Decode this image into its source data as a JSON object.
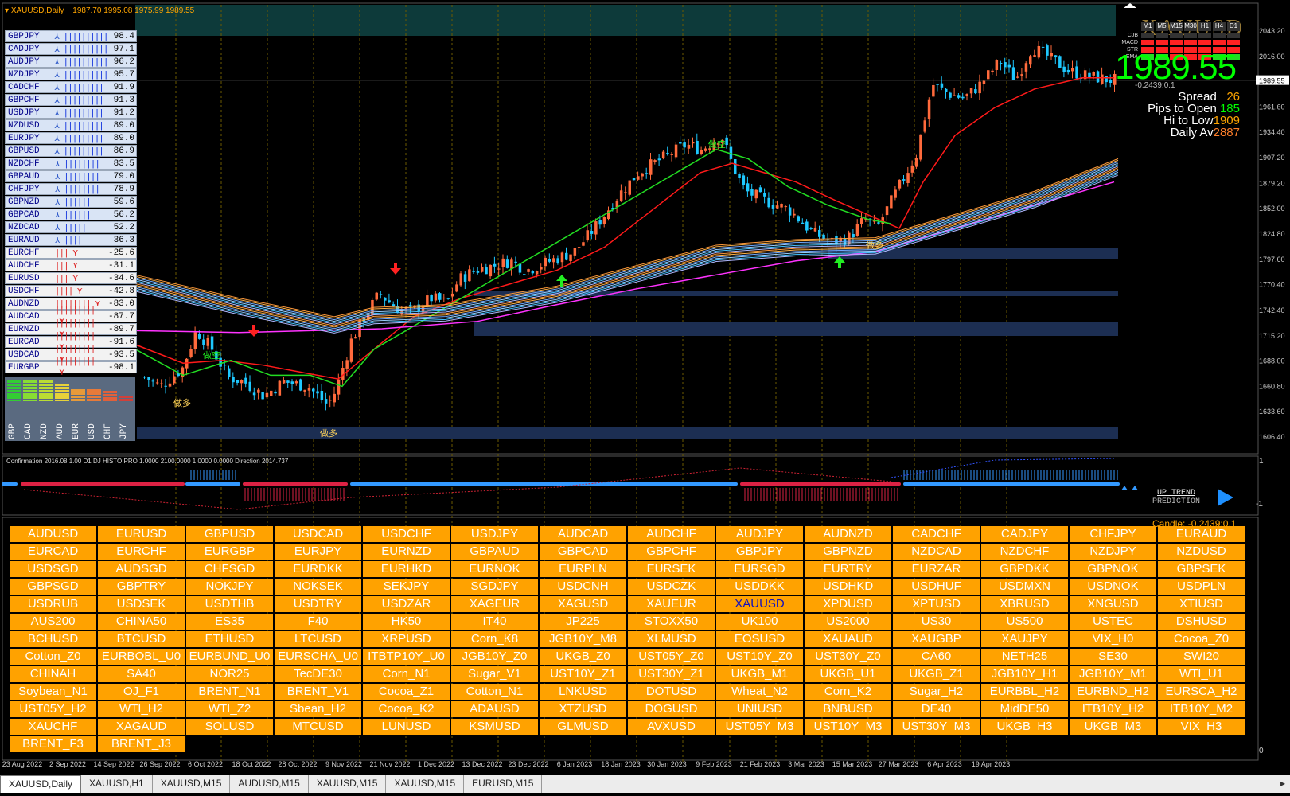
{
  "header": {
    "symbol_label": "XAUUSD,Daily",
    "ohlc": "1987.70 1995.08 1975.99 1989.55",
    "watermark": "XAUUSD"
  },
  "info_panel": {
    "timeframes": [
      "M1",
      "M5",
      "M15",
      "M30",
      "H1",
      "H4",
      "D1"
    ],
    "indicator_rows": [
      "CJB",
      "MACD",
      "STR",
      "EMA"
    ],
    "price": "1989.55",
    "change": "-0.2439:0.1",
    "spread_label": "Spread",
    "spread_value": "26",
    "pips_label": "Pips to Open",
    "pips_value": "185",
    "hilo_label": "Hi to Low",
    "hilo_value": "1909",
    "avg_label": "Daily Av",
    "avg_value": "2887"
  },
  "strength_table": [
    {
      "pair": "GBPJPY",
      "dir": "up",
      "value": "98.4"
    },
    {
      "pair": "CADJPY",
      "dir": "up",
      "value": "97.1"
    },
    {
      "pair": "AUDJPY",
      "dir": "up",
      "value": "96.2"
    },
    {
      "pair": "NZDJPY",
      "dir": "up",
      "value": "95.7"
    },
    {
      "pair": "CADCHF",
      "dir": "up",
      "value": "91.9"
    },
    {
      "pair": "GBPCHF",
      "dir": "up",
      "value": "91.3"
    },
    {
      "pair": "USDJPY",
      "dir": "up",
      "value": "91.2"
    },
    {
      "pair": "NZDUSD",
      "dir": "up",
      "value": "89.0"
    },
    {
      "pair": "EURJPY",
      "dir": "up",
      "value": "89.0"
    },
    {
      "pair": "GBPUSD",
      "dir": "up",
      "value": "86.9"
    },
    {
      "pair": "NZDCHF",
      "dir": "up",
      "value": "83.5"
    },
    {
      "pair": "GBPAUD",
      "dir": "up",
      "value": "79.0"
    },
    {
      "pair": "CHFJPY",
      "dir": "up",
      "value": "78.9"
    },
    {
      "pair": "GBPNZD",
      "dir": "up",
      "value": "59.6"
    },
    {
      "pair": "GBPCAD",
      "dir": "up",
      "value": "56.2"
    },
    {
      "pair": "NZDCAD",
      "dir": "up",
      "value": "52.2"
    },
    {
      "pair": "EURAUD",
      "dir": "up",
      "value": "36.3"
    },
    {
      "pair": "EURCHF",
      "dir": "down",
      "value": "-25.6"
    },
    {
      "pair": "AUDCHF",
      "dir": "down",
      "value": "-31.1"
    },
    {
      "pair": "EURUSD",
      "dir": "down",
      "value": "-34.6"
    },
    {
      "pair": "USDCHF",
      "dir": "down",
      "value": "-42.8"
    },
    {
      "pair": "AUDNZD",
      "dir": "down",
      "value": "-83.0"
    },
    {
      "pair": "AUDCAD",
      "dir": "down",
      "value": "-87.7"
    },
    {
      "pair": "EURNZD",
      "dir": "down",
      "value": "-89.7"
    },
    {
      "pair": "EURCAD",
      "dir": "down",
      "value": "-91.6"
    },
    {
      "pair": "USDCAD",
      "dir": "down",
      "value": "-93.5"
    },
    {
      "pair": "EURGBP",
      "dir": "down",
      "value": "-98.1"
    }
  ],
  "currency_strength": [
    "GBP",
    "CAD",
    "NZD",
    "AUD",
    "EUR",
    "USD",
    "CHF",
    "JPY"
  ],
  "price_axis": [
    "2043.20",
    "2016.00",
    "1989.55",
    "1961.60",
    "1934.40",
    "1907.20",
    "1879.20",
    "1852.00",
    "1824.80",
    "1797.60",
    "1770.40",
    "1742.40",
    "1715.20",
    "1688.00",
    "1660.80",
    "1633.60",
    "1606.40"
  ],
  "date_axis": [
    "23 Aug 2022",
    "2 Sep 2022",
    "14 Sep 2022",
    "26 Sep 2022",
    "6 Oct 2022",
    "18 Oct 2022",
    "28 Oct 2022",
    "9 Nov 2022",
    "21 Nov 2022",
    "1 Dec 2022",
    "13 Dec 2022",
    "23 Dec 2022",
    "6 Jan 2023",
    "18 Jan 2023",
    "30 Jan 2023",
    "9 Feb 2023",
    "21 Feb 2023",
    "3 Mar 2023",
    "15 Mar 2023",
    "27 Mar 2023",
    "6 Apr 2023",
    "19 Apr 2023"
  ],
  "chart_labels": {
    "long": "做多",
    "short": "做空"
  },
  "sub_indicator": {
    "label": "Confirmation 2016.08 1.00  D1 DJ HISTO PRO 1.0000 2100.0000 1.0000 0.0000  Direction 2014.737",
    "trend_line1": "UP TREND",
    "trend_line2": "PREDICTION",
    "axis_top": "1",
    "axis_bottom": "-1"
  },
  "candle_label": "Candle: -0.2439:0.1",
  "bottom_axis_zero": "0",
  "symbol_buttons": [
    "AUDUSD",
    "EURUSD",
    "GBPUSD",
    "USDCAD",
    "USDCHF",
    "USDJPY",
    "AUDCAD",
    "AUDCHF",
    "AUDJPY",
    "AUDNZD",
    "CADCHF",
    "CADJPY",
    "CHFJPY",
    "EURAUD",
    "EURCAD",
    "EURCHF",
    "EURGBP",
    "EURJPY",
    "EURNZD",
    "GBPAUD",
    "GBPCAD",
    "GBPCHF",
    "GBPJPY",
    "GBPNZD",
    "NZDCAD",
    "NZDCHF",
    "NZDJPY",
    "NZDUSD",
    "USDSGD",
    "AUDSGD",
    "CHFSGD",
    "EURDKK",
    "EURHKD",
    "EURNOK",
    "EURPLN",
    "EURSEK",
    "EURSGD",
    "EURTRY",
    "EURZAR",
    "GBPDKK",
    "GBPNOK",
    "GBPSEK",
    "GBPSGD",
    "GBPTRY",
    "NOKJPY",
    "NOKSEK",
    "SEKJPY",
    "SGDJPY",
    "USDCNH",
    "USDCZK",
    "USDDKK",
    "USDHKD",
    "USDHUF",
    "USDMXN",
    "USDNOK",
    "USDPLN",
    "USDRUB",
    "USDSEK",
    "USDTHB",
    "USDTRY",
    "USDZAR",
    "XAGEUR",
    "XAGUSD",
    "XAUEUR",
    "XAUUSD",
    "XPDUSD",
    "XPTUSD",
    "XBRUSD",
    "XNGUSD",
    "XTIUSD",
    "AUS200",
    "CHINA50",
    "ES35",
    "F40",
    "HK50",
    "IT40",
    "JP225",
    "STOXX50",
    "UK100",
    "US2000",
    "US30",
    "US500",
    "USTEC",
    "DSHUSD",
    "BCHUSD",
    "BTCUSD",
    "ETHUSD",
    "LTCUSD",
    "XRPUSD",
    "Corn_K8",
    "JGB10Y_M8",
    "XLMUSD",
    "EOSUSD",
    "XAUAUD",
    "XAUGBP",
    "XAUJPY",
    "VIX_H0",
    "Cocoa_Z0",
    "Cotton_Z0",
    "EURBOBL_U0",
    "EURBUND_U0",
    "EURSCHA_U0",
    "ITBTP10Y_U0",
    "JGB10Y_Z0",
    "UKGB_Z0",
    "UST05Y_Z0",
    "UST10Y_Z0",
    "UST30Y_Z0",
    "CA60",
    "NETH25",
    "SE30",
    "SWI20",
    "CHINAH",
    "SA40",
    "NOR25",
    "TecDE30",
    "Corn_N1",
    "Sugar_V1",
    "UST10Y_Z1",
    "UST30Y_Z1",
    "UKGB_M1",
    "UKGB_U1",
    "UKGB_Z1",
    "JGB10Y_H1",
    "JGB10Y_M1",
    "WTI_U1",
    "Soybean_N1",
    "OJ_F1",
    "BRENT_N1",
    "BRENT_V1",
    "Cocoa_Z1",
    "Cotton_N1",
    "LNKUSD",
    "DOTUSD",
    "Wheat_N2",
    "Corn_K2",
    "Sugar_H2",
    "EURBBL_H2",
    "EURBND_H2",
    "EURSCA_H2",
    "UST05Y_H2",
    "WTI_H2",
    "WTI_Z2",
    "Sbean_H2",
    "Cocoa_K2",
    "ADAUSD",
    "XTZUSD",
    "DOGUSD",
    "UNIUSD",
    "BNBUSD",
    "DE40",
    "MidDE50",
    "ITB10Y_H2",
    "ITB10Y_M2",
    "XAUCHF",
    "XAGAUD",
    "SOLUSD",
    "MTCUSD",
    "LUNUSD",
    "KSMUSD",
    "GLMUSD",
    "AVXUSD",
    "UST05Y_M3",
    "UST10Y_M3",
    "UST30Y_M3",
    "UKGB_H3",
    "UKGB_M3",
    "VIX_H3",
    "BRENT_F3",
    "BRENT_J3"
  ],
  "selected_symbol": "XAUUSD",
  "tabs": [
    "XAUUSD,Daily",
    "XAUUSD,H1",
    "XAUUSD,M15",
    "AUDUSD,M15",
    "XAUUSD,M15",
    "XAUUSD,M15",
    "EURUSD,M15"
  ],
  "colors": {
    "bull": "#ff6a3c",
    "bear": "#1ec8ff",
    "ema_red": "#ff1a1a",
    "ema_green": "#22dd22",
    "ema_magenta": "#ff33ff",
    "button": "#ffa200",
    "zone": "#1c2e52"
  }
}
